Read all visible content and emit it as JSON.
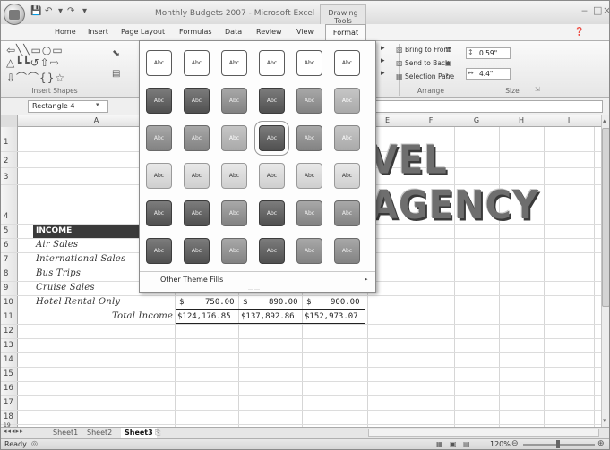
{
  "window": {
    "title": "Monthly Budgets 2007 - Microsoft Excel",
    "contextual_tab_group": "Drawing Tools"
  },
  "tabs": [
    "Home",
    "Insert",
    "Page Layout",
    "Formulas",
    "Data",
    "Review",
    "View",
    "Format"
  ],
  "ribbon": {
    "insert_shapes_label": "Insert Shapes",
    "arrange_label": "Arrange",
    "size_label": "Size",
    "arrange_items": [
      "Bring to Front",
      "Send to Back",
      "Selection Pane"
    ],
    "height_value": "0.59\"",
    "width_value": "4.4\""
  },
  "formula_bar": {
    "name_box": "Rectangle 4"
  },
  "columns": [
    "A",
    "E",
    "F",
    "G",
    "H",
    "I"
  ],
  "rows": [
    "1",
    "2",
    "3",
    "4",
    "5",
    "6",
    "7",
    "8",
    "9",
    "10",
    "11",
    "12",
    "13",
    "14",
    "15",
    "16",
    "17",
    "18",
    "19"
  ],
  "cells": {
    "income_header": "INCOME",
    "air_sales": "Air Sales",
    "international_sales": "International Sales",
    "bus_trips": "Bus Trips",
    "cruise_sales": "Cruise Sales",
    "hotel_rental": "Hotel Rental Only",
    "total_income": "Total Income",
    "row10": [
      "$",
      "750.00",
      "$",
      "890.00",
      "$",
      "900.00"
    ],
    "row11": [
      "$124,176.85",
      "$137,892.86",
      "$152,973.07"
    ],
    "wordart": "VEL AGENCY"
  },
  "gallery": {
    "swatch_label": "Abc",
    "other_fills": "Other Theme Fills"
  },
  "sheets": [
    "Sheet1",
    "Sheet2",
    "Sheet3"
  ],
  "status": {
    "ready": "Ready",
    "zoom": "120%"
  }
}
